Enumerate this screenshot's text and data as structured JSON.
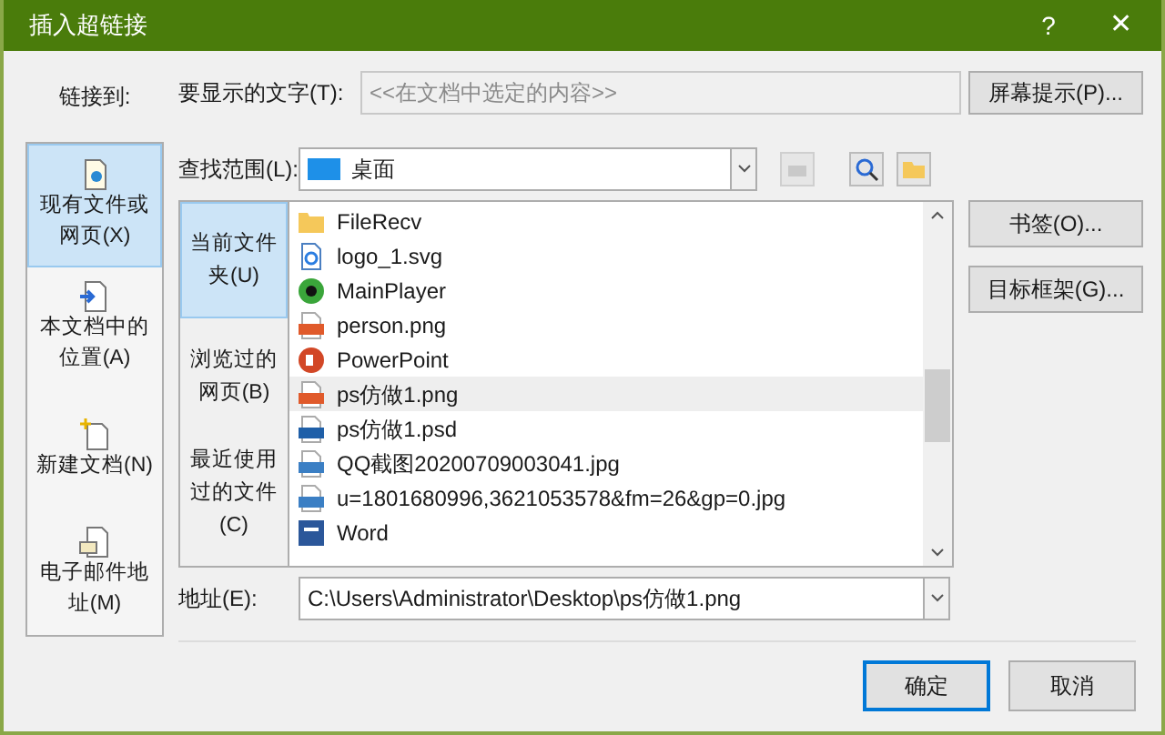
{
  "window": {
    "title": "插入超链接",
    "help": "?",
    "close": "✕"
  },
  "link_to": {
    "label": "链接到:",
    "items": [
      {
        "label": "现有文件或网页(X)",
        "kind": "file",
        "selected": true
      },
      {
        "label": "本文档中的位置(A)",
        "kind": "place",
        "selected": false
      },
      {
        "label": "新建文档(N)",
        "kind": "new",
        "selected": false
      },
      {
        "label": "电子邮件地址(M)",
        "kind": "mail",
        "selected": false
      }
    ]
  },
  "display_text": {
    "label": "要显示的文字(T):",
    "value": "<<在文档中选定的内容>>",
    "disabled": true
  },
  "screen_tip_button": "屏幕提示(P)...",
  "look_in": {
    "label": "查找范围(L):",
    "value": "桌面"
  },
  "browse_nav": [
    {
      "label": "当前文件夹(U)",
      "selected": true
    },
    {
      "label": "浏览过的网页(B)",
      "selected": false
    },
    {
      "label": "最近使用过的文件(C)",
      "selected": false
    }
  ],
  "files": [
    {
      "name": "FileRecv",
      "kind": "folder",
      "selected": false
    },
    {
      "name": "logo_1.svg",
      "kind": "html",
      "selected": false
    },
    {
      "name": "MainPlayer",
      "kind": "app",
      "selected": false
    },
    {
      "name": "person.png",
      "kind": "png",
      "selected": false
    },
    {
      "name": "PowerPoint",
      "kind": "ppt",
      "selected": false
    },
    {
      "name": "ps仿做1.png",
      "kind": "png",
      "selected": true
    },
    {
      "name": "ps仿做1.psd",
      "kind": "psd",
      "selected": false
    },
    {
      "name": "QQ截图20200709003041.jpg",
      "kind": "jpg",
      "selected": false
    },
    {
      "name": "u=1801680996,3621053578&fm=26&gp=0.jpg",
      "kind": "jpg",
      "selected": false
    },
    {
      "name": "Word",
      "kind": "word",
      "selected": false
    }
  ],
  "side_buttons": [
    "书签(O)...",
    "目标框架(G)..."
  ],
  "address": {
    "label": "地址(E):",
    "value": "C:\\Users\\Administrator\\Desktop\\ps仿做1.png"
  },
  "buttons": [
    {
      "label": "确定",
      "kind": "default"
    },
    {
      "label": "取消",
      "kind": "normal"
    }
  ]
}
